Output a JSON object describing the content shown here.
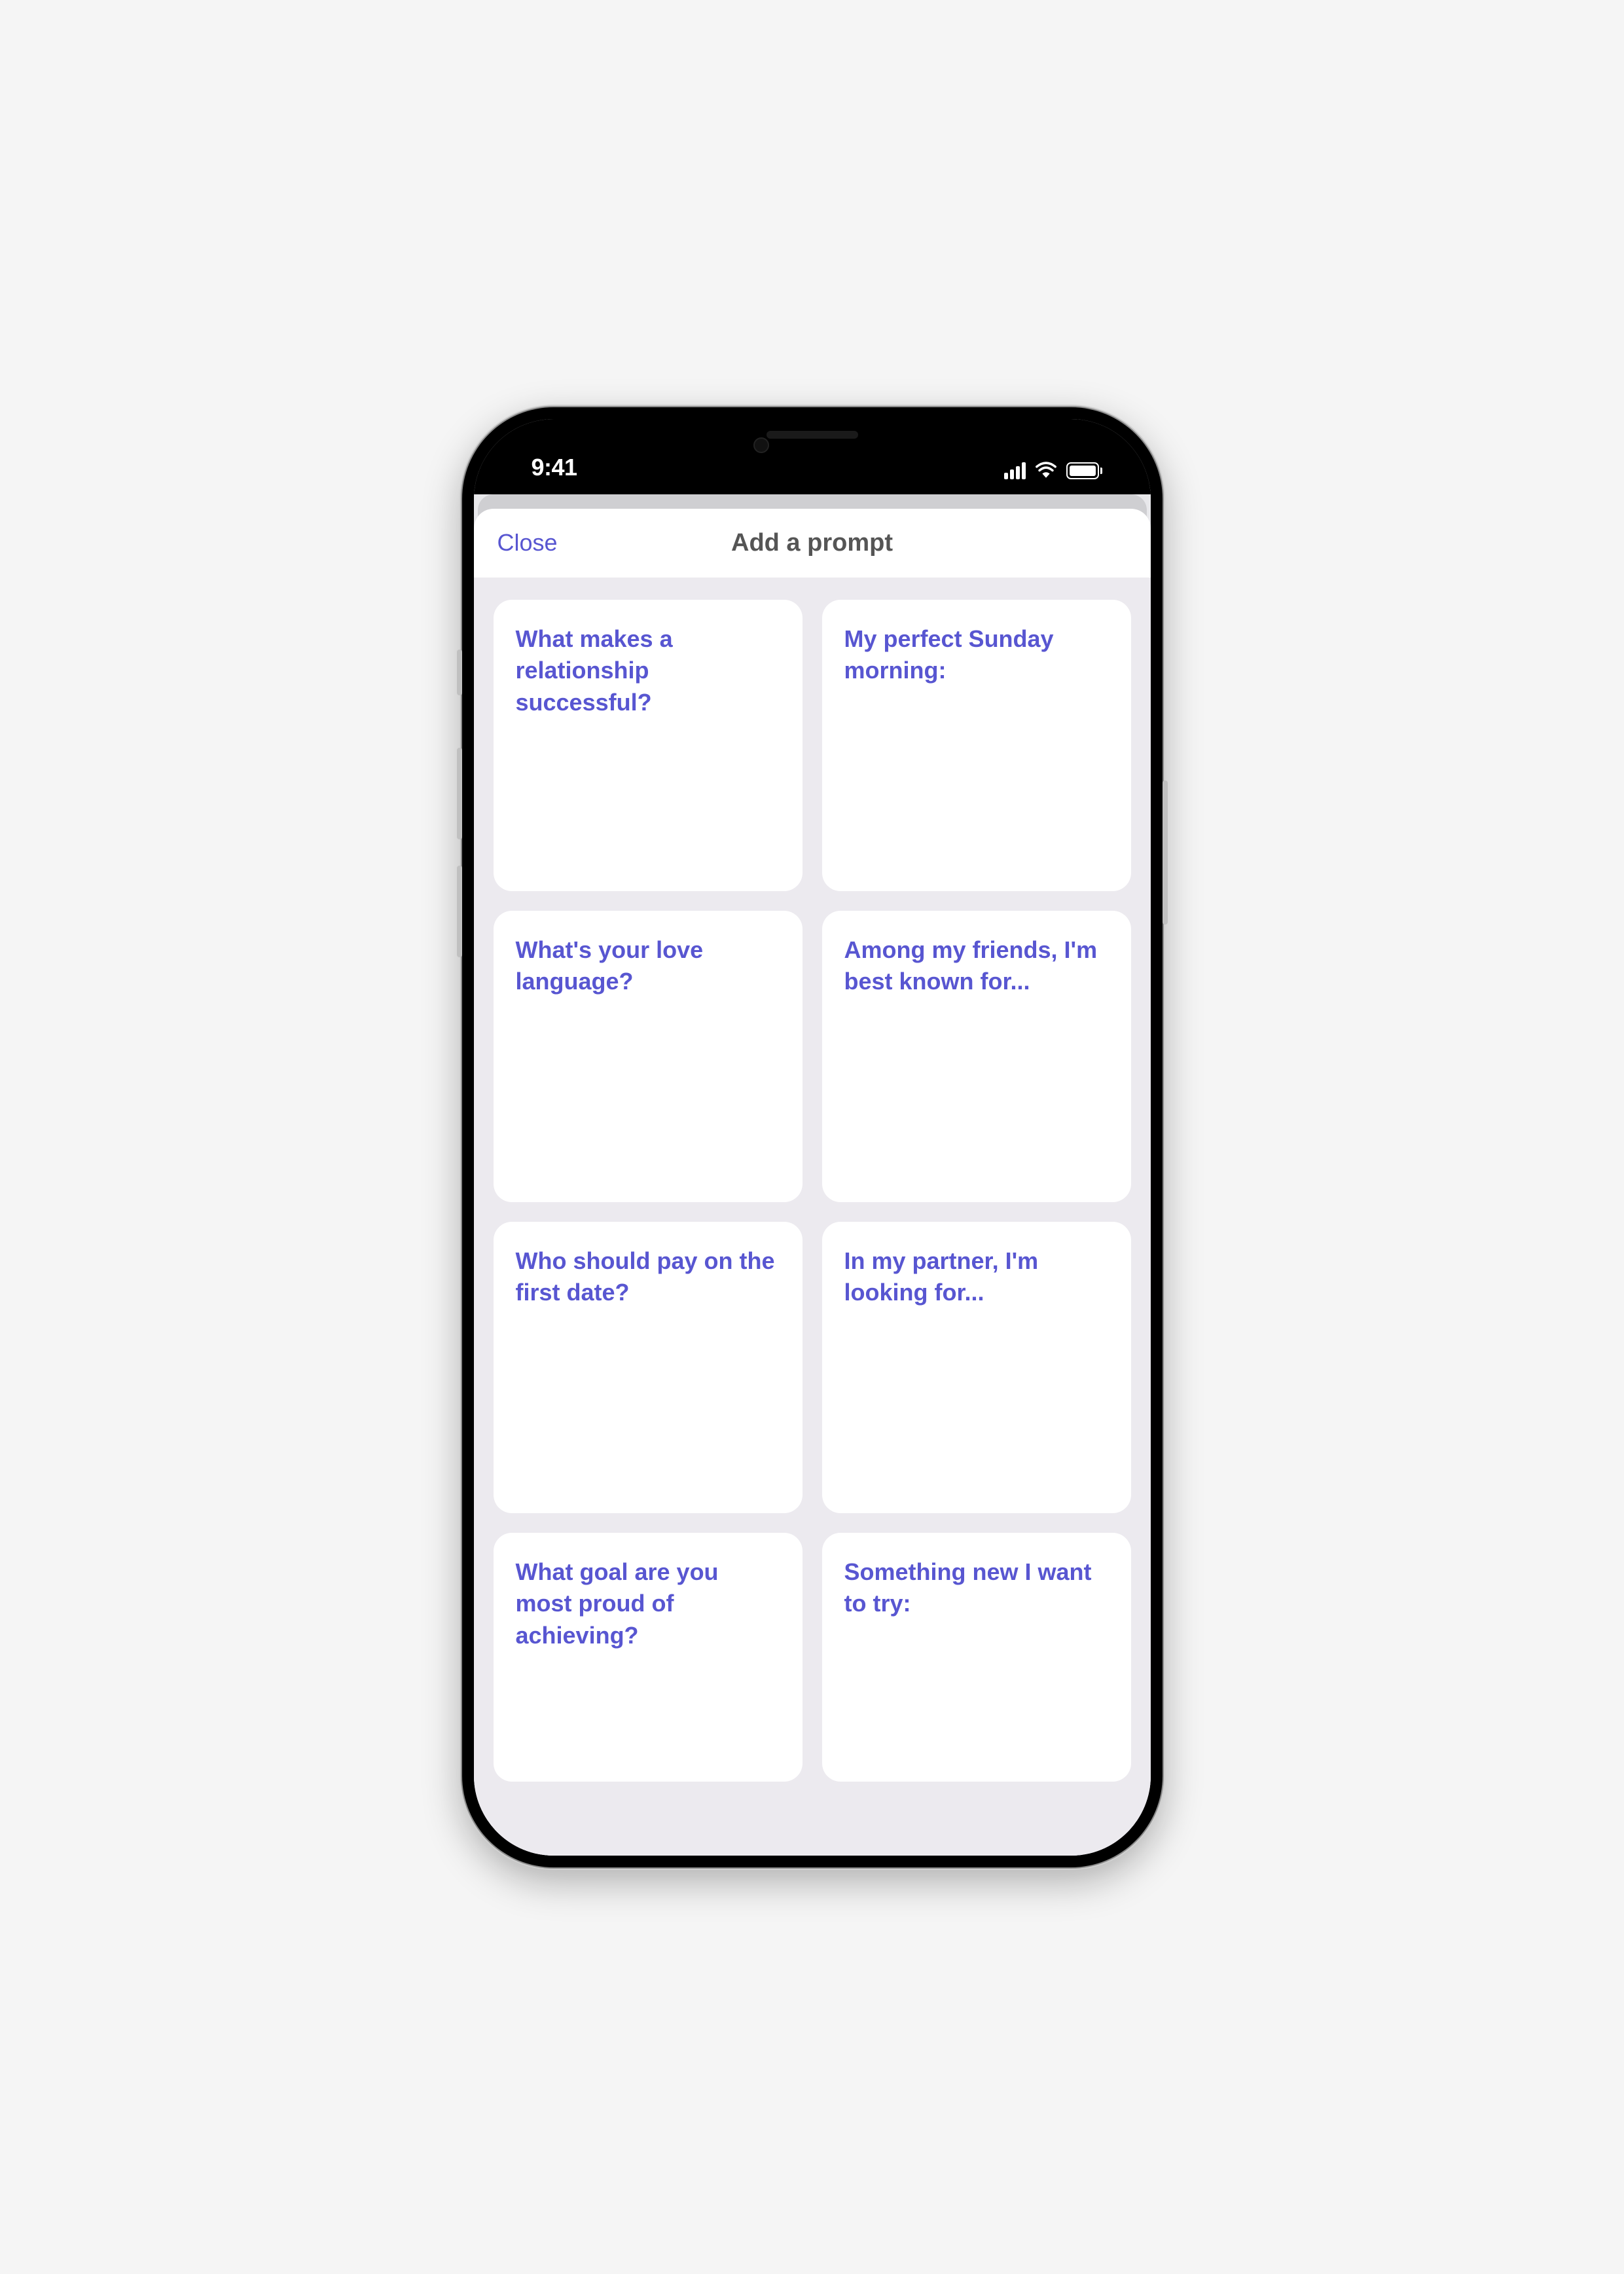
{
  "status": {
    "time": "9:41"
  },
  "sheet": {
    "close_label": "Close",
    "title": "Add a prompt"
  },
  "prompts": [
    "What makes a relationship successful?",
    "My perfect Sunday morning:",
    "What's your love language?",
    "Among my friends, I'm best known for...",
    "Who should pay on the first date?",
    "In my partner, I'm looking for...",
    "What goal are you most proud of achieving?",
    "Something new I want to try:"
  ]
}
